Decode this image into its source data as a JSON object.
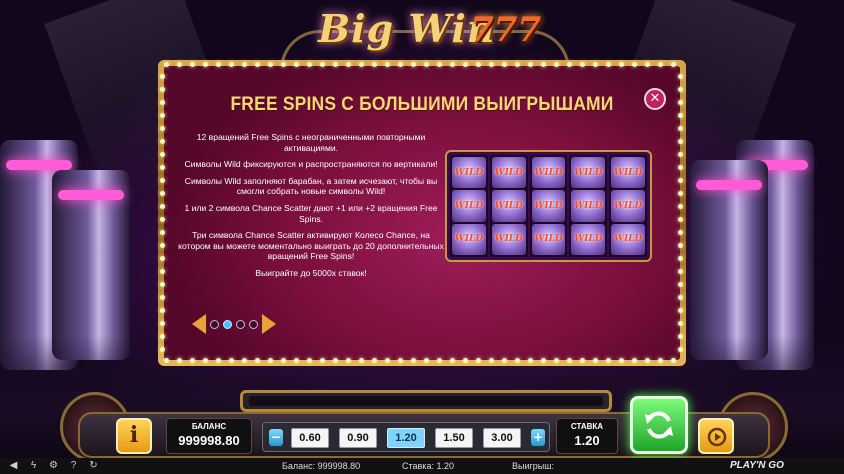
{
  "logo": {
    "text": "Big Win",
    "suffix": "777"
  },
  "panel": {
    "title": "FREE SPINS С БОЛЬШИМИ ВЫИГРЫШАМИ",
    "paragraphs": [
      "12 вращений Free Spins с неограниченными повторными активациями.",
      "Символы Wild фиксируются и распространяются по вертикали!",
      "Символы Wild заполняют барабан, а затем исчезают, чтобы вы смогли собрать новые символы Wild!",
      "1 или 2 символа Chance Scatter дают +1 или +2 вращения Free Spins.",
      "Три символа Chance Scatter активируют Колесо Chance, на котором вы можете моментально выиграть до 20 дополнительных вращений Free Spins!",
      "Выиграйте до 5000х ставок!"
    ],
    "reel_symbol": "WILD",
    "pager": {
      "pages": 4,
      "current": 2
    }
  },
  "controls": {
    "info_label": "i",
    "balance_label": "БАЛАНС",
    "balance_value": "999998.80",
    "bet_options": [
      "0.60",
      "0.90",
      "1.20",
      "1.50",
      "3.00"
    ],
    "bet_selected": "1.20",
    "minus_label": "−",
    "plus_label": "+",
    "stake_label": "СТАВКА",
    "stake_value": "1.20"
  },
  "status_bar": {
    "balance": "Баланс: 999998.80",
    "stake": "Ставка: 1.20",
    "win": "Выигрыш:",
    "brand": "PLAY'N GO",
    "icons": [
      "volume-icon",
      "lightning-icon",
      "settings-icon",
      "question-icon",
      "history-icon"
    ]
  },
  "colors": {
    "gold": "#f7d675",
    "panel_bg": "#7a0f3d",
    "spin_green": "#1ea52a",
    "selected_bet": "#7fd3ff"
  }
}
